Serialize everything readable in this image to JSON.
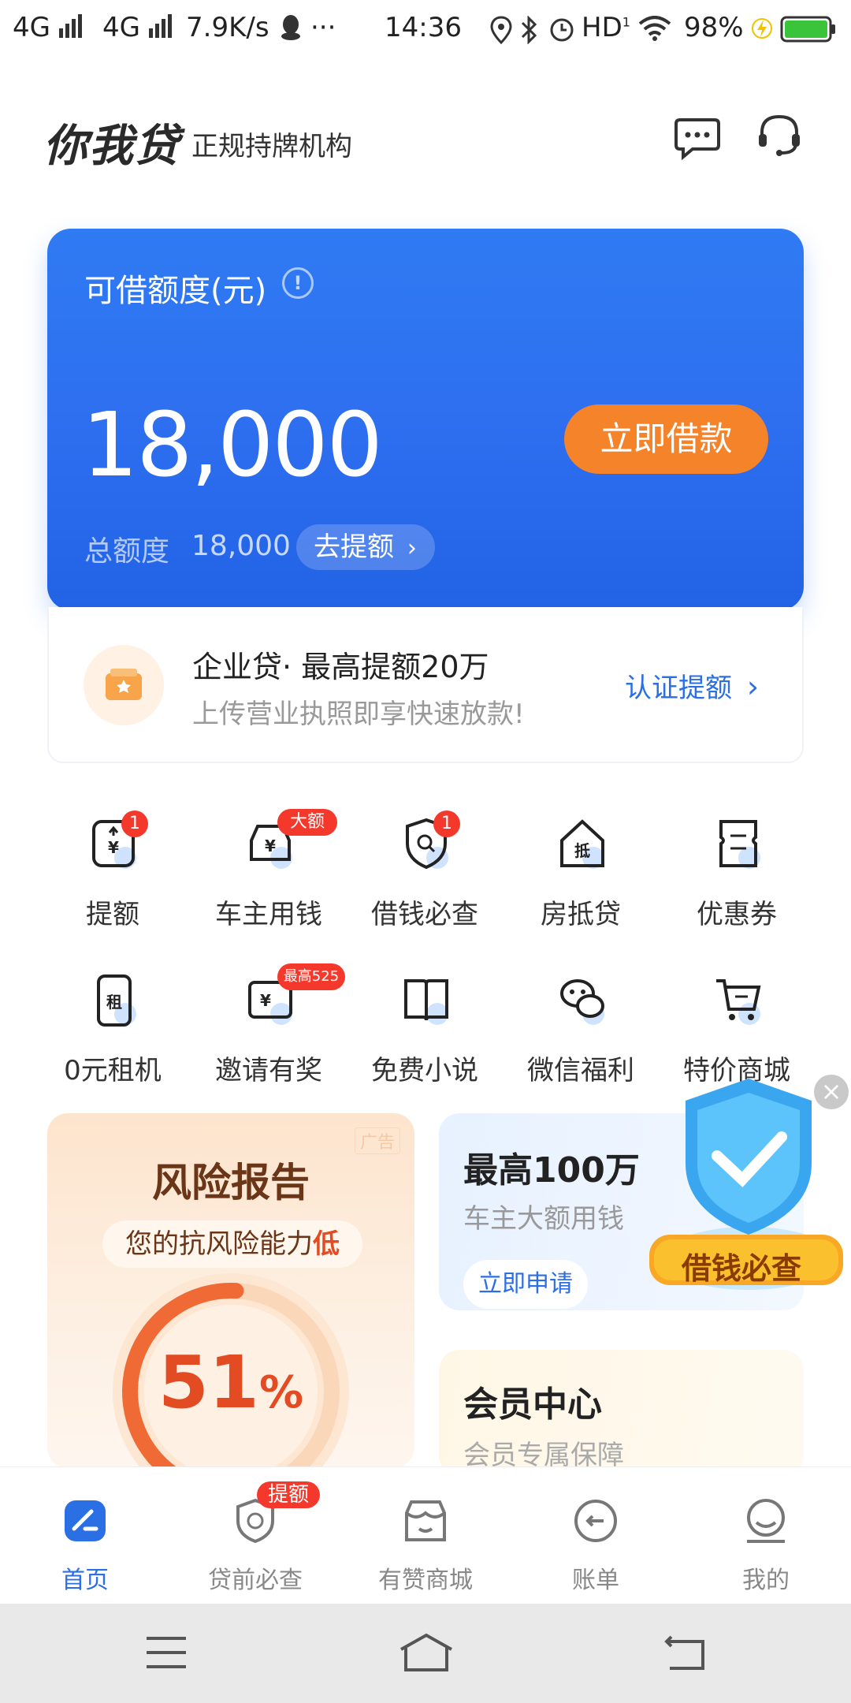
{
  "status_bar": {
    "network1": "4G",
    "network2": "4G",
    "speed": "7.9K/s",
    "more": "···",
    "time": "14:36",
    "hd": "HD",
    "battery": "98%"
  },
  "header": {
    "logo": "你我贷",
    "slogan": "正规持牌机构"
  },
  "credit_card": {
    "title": "可借额度(元)",
    "amount": "18,000",
    "borrow_label": "立即借款",
    "total_label": "总额度",
    "total_value": "18,000",
    "raise_label": "去提额"
  },
  "enterprise": {
    "title": "企业贷· 最高提额20万",
    "subtitle": "上传营业执照即享快速放款!",
    "cta": "认证提额"
  },
  "services": [
    {
      "label": "提额",
      "badge": "1",
      "icon": "yuan-arrow-icon"
    },
    {
      "label": "车主用钱",
      "badge": "大额",
      "icon": "car-yuan-icon"
    },
    {
      "label": "借钱必查",
      "badge": "1",
      "icon": "shield-search-icon"
    },
    {
      "label": "房抵贷",
      "badge": "",
      "icon": "house-icon",
      "glyph": "抵"
    },
    {
      "label": "优惠券",
      "badge": "",
      "icon": "coupon-icon"
    },
    {
      "label": "0元租机",
      "badge": "",
      "icon": "phone-rent-icon",
      "glyph": "租"
    },
    {
      "label": "邀请有奖",
      "badge": "最高525",
      "icon": "invite-icon"
    },
    {
      "label": "免费小说",
      "badge": "",
      "icon": "book-icon"
    },
    {
      "label": "微信福利",
      "badge": "",
      "icon": "wechat-icon"
    },
    {
      "label": "特价商城",
      "badge": "",
      "icon": "cart-icon"
    }
  ],
  "risk_card": {
    "ad_tag": "广告",
    "title": "风险报告",
    "pill_prefix": "您的抗风险能力",
    "pill_level": "低",
    "percent": "51",
    "percent_unit": "%",
    "gauge_fraction": 0.51
  },
  "loan_card": {
    "title": "最高100万",
    "subtitle": "车主大额用钱",
    "apply": "立即申请"
  },
  "vip_card": {
    "title": "会员中心",
    "subtitle": "会员专属保障"
  },
  "float_ad": {
    "label": "借钱必查",
    "close": "×"
  },
  "tabs": [
    {
      "label": "首页",
      "active": true,
      "icon": "home-icon"
    },
    {
      "label": "贷前必查",
      "badge": "提额",
      "icon": "shield-check-icon"
    },
    {
      "label": "有赞商城",
      "icon": "shop-icon"
    },
    {
      "label": "账单",
      "icon": "bill-icon"
    },
    {
      "label": "我的",
      "icon": "profile-icon"
    }
  ],
  "colors": {
    "brand_blue": "#2e6ff0",
    "accent_orange": "#f5832a",
    "badge_red": "#f4382c",
    "link_blue": "#2b6fe4"
  }
}
